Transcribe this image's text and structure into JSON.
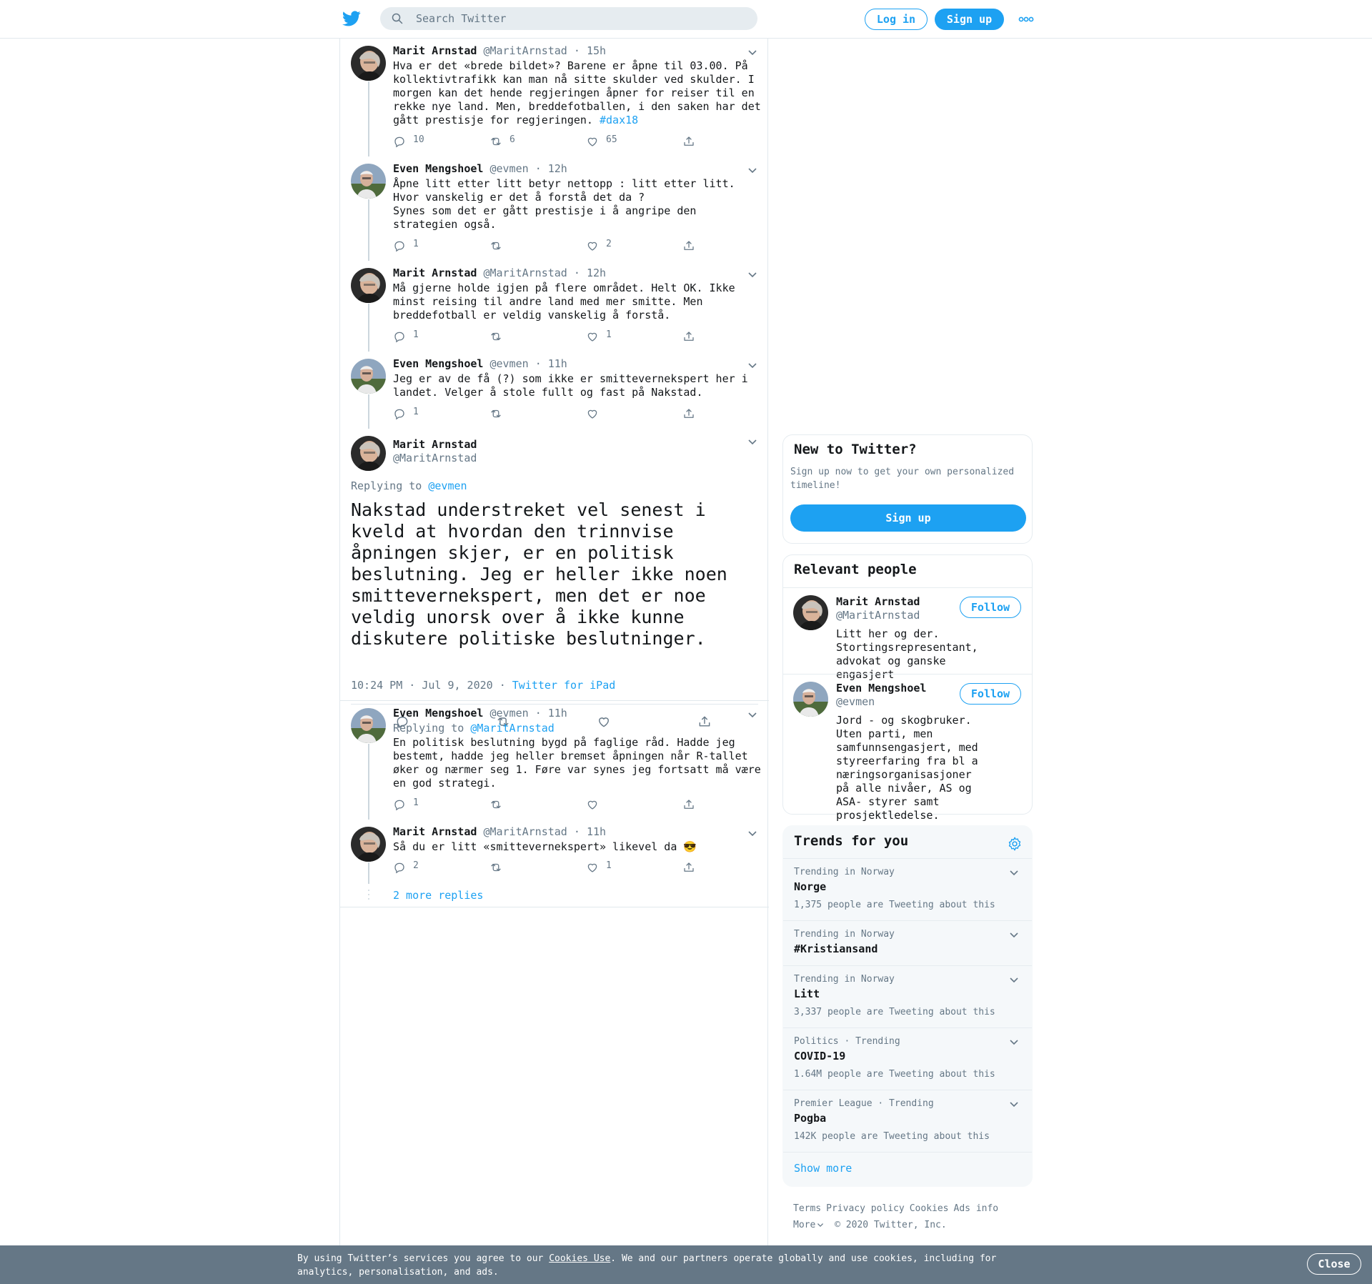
{
  "header": {
    "search_placeholder": "Search Twitter",
    "login_label": "Log in",
    "signup_label": "Sign up",
    "brand_color": "#1da1f2"
  },
  "thread": [
    {
      "name": "Marit Arnstad",
      "handle": "@MaritArnstad",
      "time": "15h",
      "text": "Hva er det «brede bildet»? Barene er åpne til 03.00. På kollektivtrafikk kan man nå sitte skulder ved skulder. I morgen kan det hende regjeringen åpner for reiser til en rekke nye land. Men, breddefotballen, i den saken har det gått prestisje for regjeringen. ",
      "hashtag": "#dax18",
      "replies": "10",
      "retweets": "6",
      "likes": "65"
    },
    {
      "name": "Even Mengshoel",
      "handle": "@evmen",
      "time": "12h",
      "text": "Åpne litt etter litt betyr nettopp : litt etter litt. Hvor vanskelig er det å forstå det da ?\nSynes som det er gått prestisje i å angripe den strategien også.",
      "replies": "1",
      "retweets": "",
      "likes": "2"
    },
    {
      "name": "Marit Arnstad",
      "handle": "@MaritArnstad",
      "time": "12h",
      "text": "Må gjerne holde igjen på flere området. Helt OK. Ikke minst reising til andre land med mer smitte. Men breddefotball er veldig vanskelig å forstå.",
      "replies": "1",
      "retweets": "",
      "likes": "1"
    },
    {
      "name": "Even Mengshoel",
      "handle": "@evmen",
      "time": "11h",
      "text": "Jeg er av de få (?) som ikke er smittevernekspert her i landet. Velger å stole fullt og fast på Nakstad.",
      "replies": "1",
      "retweets": "",
      "likes": ""
    }
  ],
  "main_tweet": {
    "name": "Marit Arnstad",
    "handle": "@MaritArnstad",
    "replying_prefix": "Replying to ",
    "replying_to": "@evmen",
    "text": "Nakstad understreket vel senest i kveld at hvordan den trinnvise åpningen skjer, er en politisk beslutning. Jeg er heller ikke noen smittevernekspert, men det er noe veldig unorsk over å ikke kunne diskutere politiske beslutninger.",
    "timestamp": "10:24 PM · Jul 9, 2020",
    "source": "Twitter for iPad"
  },
  "replies": [
    {
      "name": "Even Mengshoel",
      "handle": "@evmen",
      "time": "11h",
      "replying_prefix": "Replying to ",
      "replying_to": "@MaritArnstad",
      "text": "En politisk beslutning bygd på faglige råd. Hadde jeg bestemt, hadde jeg heller bremset åpningen når R-tallet øker og nærmer seg 1. Føre var synes jeg fortsatt må være en god strategi.",
      "replies": "1",
      "retweets": "",
      "likes": ""
    },
    {
      "name": "Marit Arnstad",
      "handle": "@MaritArnstad",
      "time": "11h",
      "text": "Så du er litt «smittevernekspert» likevel da 😎",
      "replies": "2",
      "retweets": "",
      "likes": "1"
    }
  ],
  "more_replies": "2 more replies",
  "new_to_twitter": {
    "title": "New to Twitter?",
    "subtitle": "Sign up now to get your own personalized timeline!",
    "button": "Sign up"
  },
  "relevant_people": {
    "title": "Relevant people",
    "people": [
      {
        "name": "Marit Arnstad",
        "handle": "@MaritArnstad",
        "follow": "Follow",
        "bio": "Litt her og der. Stortingsrepresentant, advokat og ganske engasjert"
      },
      {
        "name": "Even Mengshoel",
        "handle": "@evmen",
        "follow": "Follow",
        "bio": "Jord - og skogbruker. Uten parti, men samfunnsengasjert, med styreerfaring fra bl a næringsorganisasjoner på alle nivåer, AS og ASA- styrer samt prosjektledelse."
      }
    ]
  },
  "trends": {
    "title": "Trends for you",
    "items": [
      {
        "context": "Trending in Norway",
        "name": "Norge",
        "count": "1,375 people are Tweeting about this"
      },
      {
        "context": "Trending in Norway",
        "name": "#Kristiansand",
        "count": ""
      },
      {
        "context": "Trending in Norway",
        "name": "Litt",
        "count": "3,337 people are Tweeting about this"
      },
      {
        "context": "Politics · Trending",
        "name": "COVID-19",
        "count": "1.64M people are Tweeting about this"
      },
      {
        "context": "Premier League · Trending",
        "name": "Pogba",
        "count": "142K people are Tweeting about this"
      }
    ],
    "show_more": "Show more"
  },
  "footer": {
    "terms": "Terms",
    "privacy": "Privacy policy",
    "cookies": "Cookies",
    "ads": "Ads info",
    "more": "More",
    "copyright": "© 2020 Twitter, Inc."
  },
  "cookie_bar": {
    "text_before": "By using Twitter’s services you agree to our ",
    "link": "Cookies Use",
    "text_after": ". We and our partners operate globally and use cookies, including for analytics, personalisation, and ads.",
    "close": "Close"
  }
}
